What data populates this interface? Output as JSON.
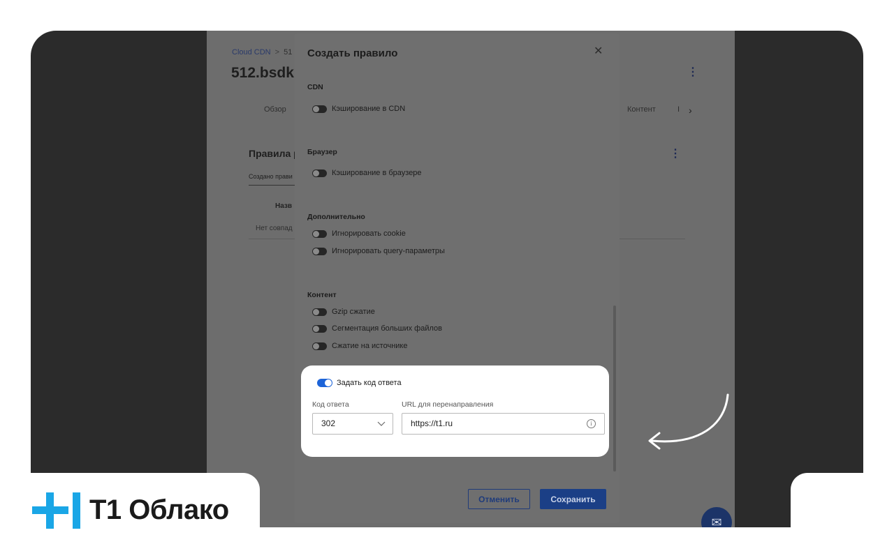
{
  "background_page": {
    "breadcrumb": {
      "root": "Cloud CDN",
      "separator": ">",
      "current": "51"
    },
    "title": "512.bsdk",
    "tabs": [
      "Обзор",
      "Контент",
      "I"
    ],
    "section_title": "Правила р",
    "subtab": "Создано прави",
    "column_header": "Назв",
    "empty_text": "Нет совпад"
  },
  "modal": {
    "title": "Создать правило",
    "sections": {
      "cdn": {
        "title": "CDN",
        "toggles": [
          "Кэширование в CDN"
        ]
      },
      "browser": {
        "title": "Браузер",
        "toggles": [
          "Кэширование в браузере"
        ]
      },
      "extra": {
        "title": "Дополнительно",
        "toggles": [
          "Игнорировать cookie",
          "Игнорировать query-параметры"
        ]
      },
      "content": {
        "title": "Контент",
        "toggles": [
          "Gzip сжатие",
          "Сегментация больших файлов",
          "Сжатие на источнике"
        ]
      }
    },
    "response": {
      "toggle_label": "Задать код ответа",
      "toggle_on": true,
      "code_label": "Код ответа",
      "code_value": "302",
      "url_label": "URL для перенаправления",
      "url_value": "https://t1.ru"
    },
    "buttons": {
      "cancel": "Отменить",
      "save": "Сохранить"
    }
  },
  "logo": {
    "text": "T1 Облако"
  },
  "colors": {
    "accent_blue": "#1d64d8",
    "save_button": "#1b3f86",
    "logo_plus": "#1aa6e6",
    "frame_dark": "#2b2b2b"
  },
  "icons": [
    "close-icon",
    "chevron-down-icon",
    "info-icon",
    "kebab-menu-icon",
    "mail-icon",
    "arrow-icon",
    "chevron-right-icon"
  ]
}
